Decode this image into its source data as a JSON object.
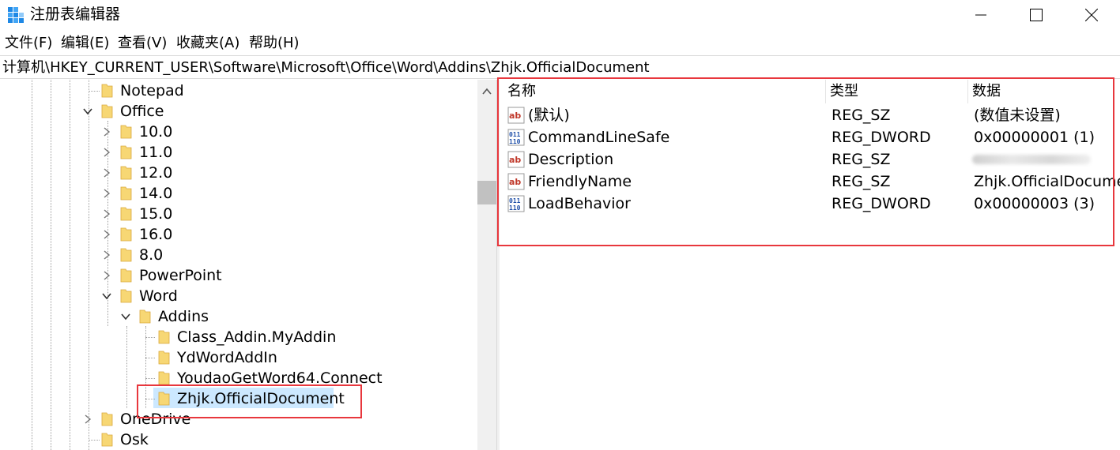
{
  "window": {
    "title": "注册表编辑器"
  },
  "menu": [
    "文件(F)",
    "编辑(E)",
    "查看(V)",
    "收藏夹(A)",
    "帮助(H)"
  ],
  "address": "计算机\\HKEY_CURRENT_USER\\Software\\Microsoft\\Office\\Word\\Addins\\Zhjk.OfficialDocument",
  "tree": {
    "notepad": "Notepad",
    "office": "Office",
    "v10": "10.0",
    "v11": "11.0",
    "v12": "12.0",
    "v14": "14.0",
    "v15": "15.0",
    "v16": "16.0",
    "v8": "8.0",
    "powerpoint": "PowerPoint",
    "word": "Word",
    "addins": "Addins",
    "class_addin": "Class_Addin.MyAddin",
    "ydword": "YdWordAddIn",
    "youdao": "YoudaoGetWord64.Connect",
    "zhjk": "Zhjk.OfficialDocument",
    "onedrive": "OneDrive",
    "osk": "Osk"
  },
  "values": {
    "headers": {
      "name": "名称",
      "type": "类型",
      "data": "数据"
    },
    "rows": [
      {
        "icon": "string-value-icon",
        "name": "(默认)",
        "type": "REG_SZ",
        "data": "(数值未设置)"
      },
      {
        "icon": "dword-value-icon",
        "name": "CommandLineSafe",
        "type": "REG_DWORD",
        "data": "0x00000001 (1)"
      },
      {
        "icon": "string-value-icon",
        "name": "Description",
        "type": "REG_SZ",
        "data": ""
      },
      {
        "icon": "string-value-icon",
        "name": "FriendlyName",
        "type": "REG_SZ",
        "data": "Zhjk.OfficialDocumen"
      },
      {
        "icon": "dword-value-icon",
        "name": "LoadBehavior",
        "type": "REG_DWORD",
        "data": "0x00000003 (3)"
      }
    ]
  },
  "colors": {
    "highlight": "#e8373d",
    "selection": "#cce8ff",
    "folder": "#f7d774"
  }
}
